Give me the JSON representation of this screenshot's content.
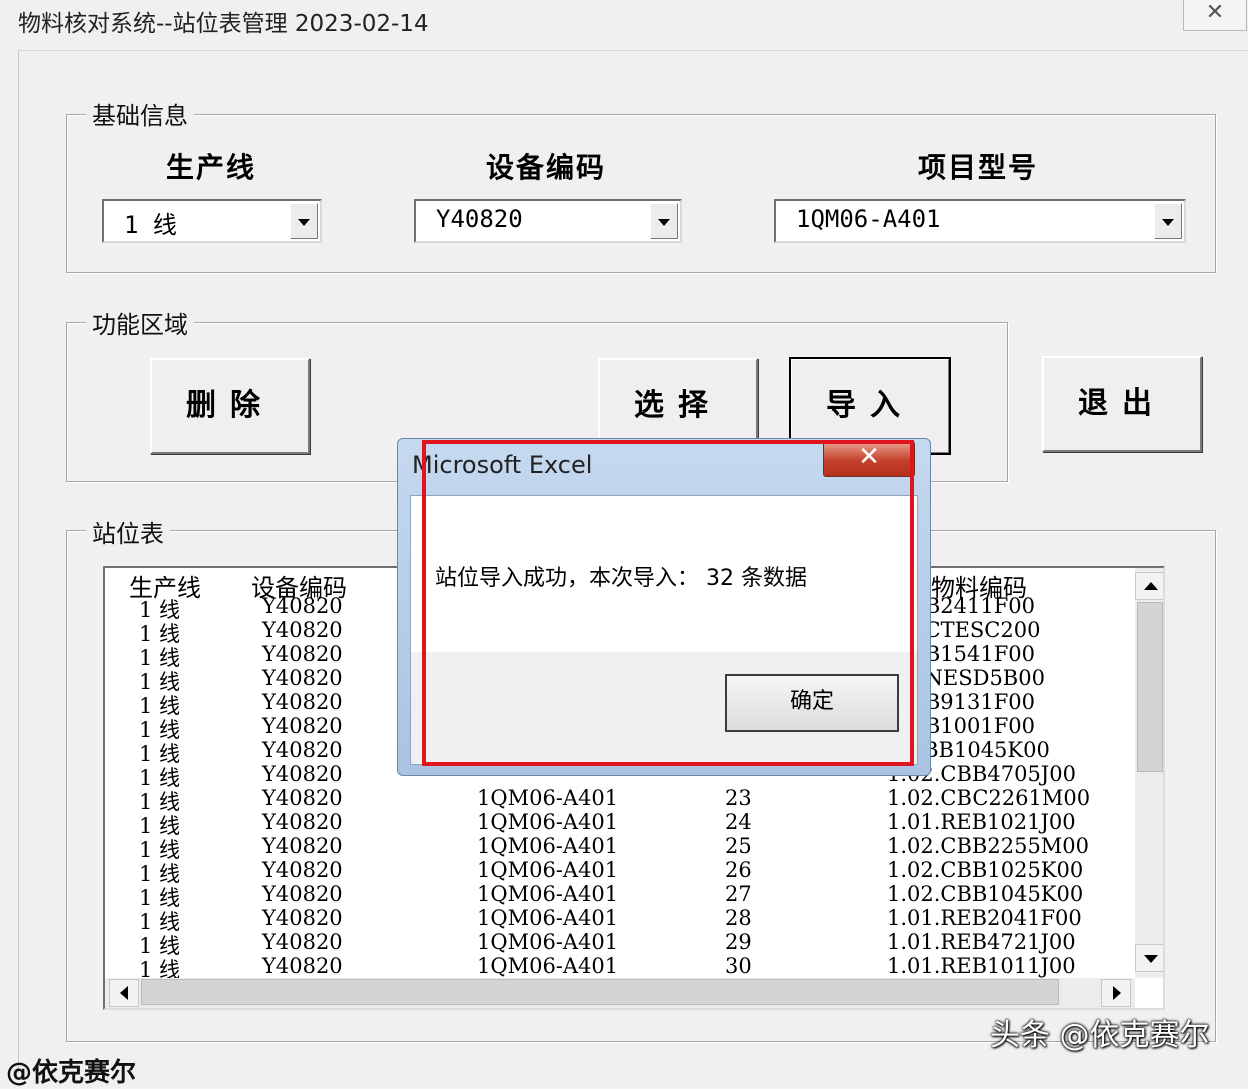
{
  "window": {
    "title": "物料核对系统--站位表管理 2023-02-14",
    "close_glyph": "✕"
  },
  "basic_info": {
    "group_label": "基础信息",
    "line_label": "生产线",
    "line_value": "1 线",
    "device_label": "设备编码",
    "device_value": "Y40820",
    "project_label": "项目型号",
    "project_value": "1QM06-A401"
  },
  "functions": {
    "group_label": "功能区域",
    "delete_label": "删除",
    "select_label": "选择",
    "import_label": "导入",
    "exit_label": "退出"
  },
  "station_table": {
    "group_label": "站位表",
    "columns": [
      "生产线",
      "设备编码",
      "",
      "",
      "物料编码"
    ],
    "rows": [
      [
        "1 线",
        "Y40820",
        "",
        "",
        ".REB2411F00"
      ],
      [
        "1 线",
        "Y40820",
        "",
        "",
        ".DTCTESC200"
      ],
      [
        "1 线",
        "Y40820",
        "",
        "",
        ".REB1541F00"
      ],
      [
        "1 线",
        "Y40820",
        "",
        "",
        ".DTNESD5B00"
      ],
      [
        "1 线",
        "Y40820",
        "",
        "",
        ".REB9131F00"
      ],
      [
        "1 线",
        "Y40820",
        "",
        "",
        ".REB1001F00"
      ],
      [
        "1 线",
        "Y40820",
        "",
        "",
        "2.CBB1045K00"
      ],
      [
        "1 线",
        "Y40820",
        "",
        "",
        "1.02.CBB4705J00"
      ],
      [
        "1 线",
        "Y40820",
        "1QM06-A401",
        "23",
        "1.02.CBC2261M00"
      ],
      [
        "1 线",
        "Y40820",
        "1QM06-A401",
        "24",
        "1.01.REB1021J00"
      ],
      [
        "1 线",
        "Y40820",
        "1QM06-A401",
        "25",
        "1.02.CBB2255M00"
      ],
      [
        "1 线",
        "Y40820",
        "1QM06-A401",
        "26",
        "1.02.CBB1025K00"
      ],
      [
        "1 线",
        "Y40820",
        "1QM06-A401",
        "27",
        "1.02.CBB1045K00"
      ],
      [
        "1 线",
        "Y40820",
        "1QM06-A401",
        "28",
        "1.01.REB2041F00"
      ],
      [
        "1 线",
        "Y40820",
        "1QM06-A401",
        "29",
        "1.01.REB4721J00"
      ],
      [
        "1 线",
        "Y40820",
        "1QM06-A401",
        "30",
        "1.01.REB1011J00"
      ]
    ]
  },
  "dialog": {
    "title": "Microsoft Excel",
    "close_glyph": "✕",
    "message": "站位导入成功，本次导入： 32 条数据",
    "ok_label": "确定"
  },
  "watermark": "头条 @依克赛尔",
  "bottom_text": "@依克赛尔",
  "colors": {
    "highlight_box": "#e0141e",
    "dialog_frame": "#a9c3e2"
  }
}
